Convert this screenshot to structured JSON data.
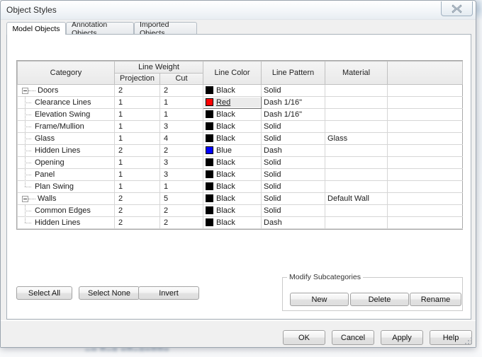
{
  "window": {
    "title": "Object Styles",
    "close_icon": "close-x-icon"
  },
  "backdrop": {
    "ribbon_label": "Properties"
  },
  "tabs": [
    {
      "label": "Model Objects",
      "active": true
    },
    {
      "label": "Annotation Objects",
      "active": false
    },
    {
      "label": "Imported Objects",
      "active": false
    }
  ],
  "grid": {
    "headers": {
      "category": "Category",
      "line_weight": "Line Weight",
      "projection": "Projection",
      "cut": "Cut",
      "line_color": "Line Color",
      "line_pattern": "Line Pattern",
      "material": "Material",
      "trailing": ""
    },
    "rows": [
      {
        "category": "Doors",
        "level": 0,
        "last": false,
        "projection": "2",
        "cut": "2",
        "color_name": "Black",
        "color_hex": "#000000",
        "pattern": "Solid",
        "material": "",
        "selected": false
      },
      {
        "category": "Clearance Lines",
        "level": 1,
        "last": false,
        "projection": "1",
        "cut": "1",
        "color_name": "Red",
        "color_hex": "#ff0000",
        "pattern": "Dash 1/16\"",
        "material": "",
        "selected": true
      },
      {
        "category": "Elevation Swing",
        "level": 1,
        "last": false,
        "projection": "1",
        "cut": "1",
        "color_name": "Black",
        "color_hex": "#000000",
        "pattern": "Dash 1/16\"",
        "material": "",
        "selected": false
      },
      {
        "category": "Frame/Mullion",
        "level": 1,
        "last": false,
        "projection": "1",
        "cut": "3",
        "color_name": "Black",
        "color_hex": "#000000",
        "pattern": "Solid",
        "material": "",
        "selected": false
      },
      {
        "category": "Glass",
        "level": 1,
        "last": false,
        "projection": "1",
        "cut": "4",
        "color_name": "Black",
        "color_hex": "#000000",
        "pattern": "Solid",
        "material": "Glass",
        "selected": false
      },
      {
        "category": "Hidden Lines",
        "level": 1,
        "last": false,
        "projection": "2",
        "cut": "2",
        "color_name": "Blue",
        "color_hex": "#0000ff",
        "pattern": "Dash",
        "material": "",
        "selected": false
      },
      {
        "category": "Opening",
        "level": 1,
        "last": false,
        "projection": "1",
        "cut": "3",
        "color_name": "Black",
        "color_hex": "#000000",
        "pattern": "Solid",
        "material": "",
        "selected": false
      },
      {
        "category": "Panel",
        "level": 1,
        "last": false,
        "projection": "1",
        "cut": "3",
        "color_name": "Black",
        "color_hex": "#000000",
        "pattern": "Solid",
        "material": "",
        "selected": false
      },
      {
        "category": "Plan Swing",
        "level": 1,
        "last": true,
        "projection": "1",
        "cut": "1",
        "color_name": "Black",
        "color_hex": "#000000",
        "pattern": "Solid",
        "material": "",
        "selected": false
      },
      {
        "category": "Walls",
        "level": 0,
        "last": false,
        "projection": "2",
        "cut": "5",
        "color_name": "Black",
        "color_hex": "#000000",
        "pattern": "Solid",
        "material": "Default Wall",
        "selected": false
      },
      {
        "category": "Common Edges",
        "level": 1,
        "last": false,
        "projection": "2",
        "cut": "2",
        "color_name": "Black",
        "color_hex": "#000000",
        "pattern": "Solid",
        "material": "",
        "selected": false
      },
      {
        "category": "Hidden Lines",
        "level": 1,
        "last": true,
        "projection": "2",
        "cut": "2",
        "color_name": "Black",
        "color_hex": "#000000",
        "pattern": "Dash",
        "material": "",
        "selected": false
      }
    ]
  },
  "selection_buttons": {
    "select_all": "Select All",
    "select_none": "Select None",
    "invert": "Invert"
  },
  "modify_subcategories": {
    "legend": "Modify Subcategories",
    "new": "New",
    "delete": "Delete",
    "rename": "Rename"
  },
  "footer_buttons": {
    "ok": "OK",
    "cancel": "Cancel",
    "apply": "Apply",
    "help": "Help"
  }
}
